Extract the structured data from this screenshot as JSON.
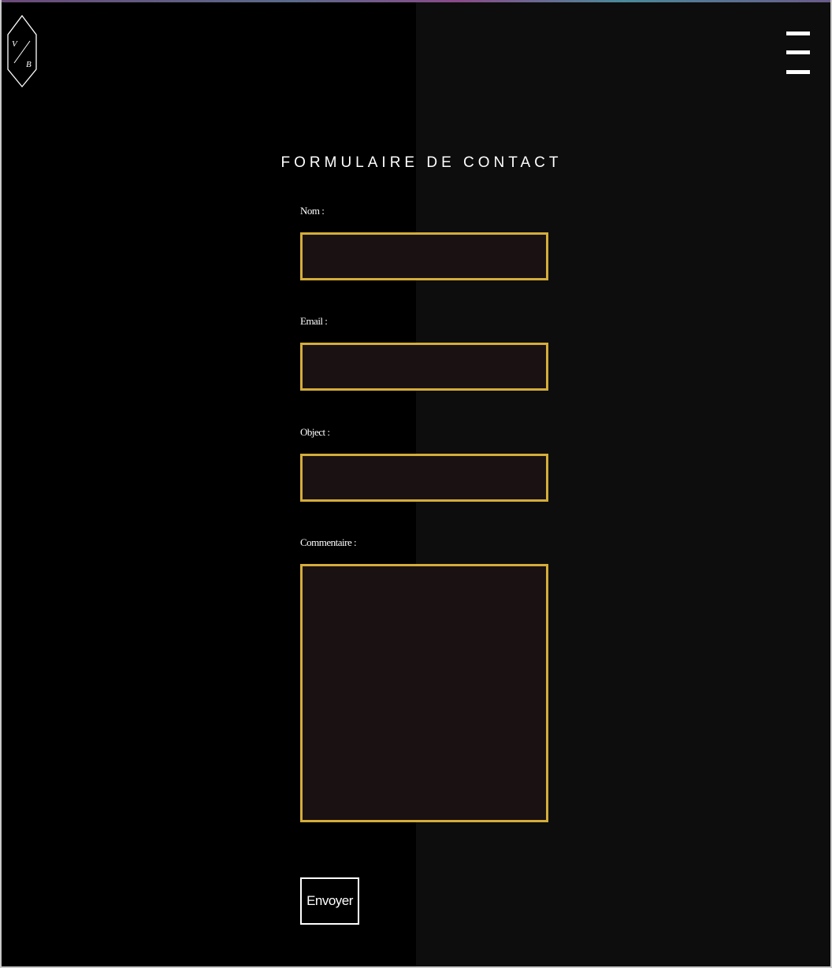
{
  "logo": {
    "name": "vb-hexagon-logo",
    "letters": [
      "V",
      "B"
    ]
  },
  "header": {
    "menu_icon": "hamburger-menu-icon"
  },
  "form": {
    "title": "FORMULAIRE DE CONTACT",
    "fields": {
      "name": {
        "label": "Nom :",
        "value": ""
      },
      "email": {
        "label": "Email :",
        "value": ""
      },
      "object": {
        "label": "Object :",
        "value": ""
      },
      "comment": {
        "label": "Commentaire :",
        "value": ""
      }
    },
    "submit_label": "Envoyer"
  },
  "colors": {
    "background_left": "#000000",
    "background_right": "#0d0d0d",
    "input_border": "#d4ad3a",
    "input_fill": "#1a1112",
    "text": "#ffffff"
  }
}
